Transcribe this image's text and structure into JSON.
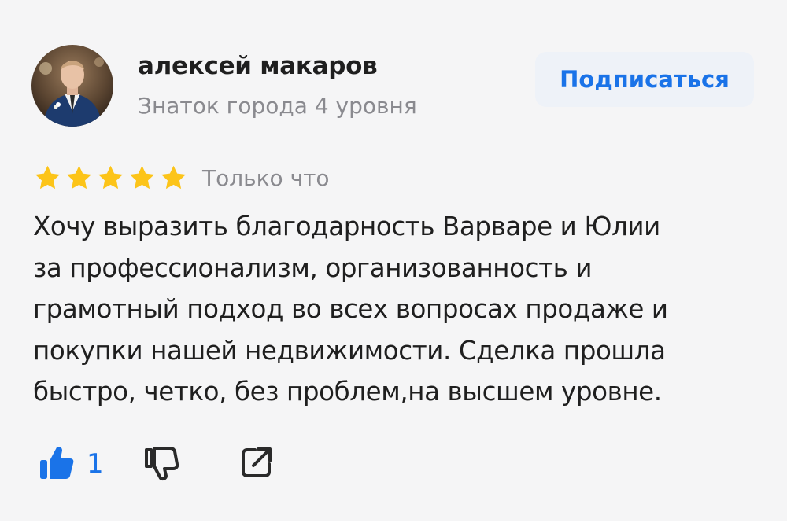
{
  "author": {
    "name": "алексей макаров",
    "level": "Знаток города 4 уровня"
  },
  "subscribe": {
    "label": "Подписаться"
  },
  "review": {
    "rating": 5,
    "max_rating": 5,
    "date": "Только что",
    "lines": [
      "Хочу выразить благодарность Варваре и Юлии",
      "за профессионализм, организованность и",
      "грамотный подход во всех вопросах продаже и",
      "покупки нашей недвижимости. Сделка прошла",
      "быстро, четко, без проблем,на высшем уровне."
    ]
  },
  "actions": {
    "like_count": "1",
    "like_icon": "thumbs-up-icon",
    "dislike_icon": "thumbs-down-icon",
    "share_icon": "share-icon"
  },
  "colors": {
    "accent": "#1a73e8",
    "star": "#fcc419",
    "background": "#f5f5f6",
    "text": "#1f1f1f",
    "muted": "#8a8a8f",
    "button_bg": "#eef2f8"
  }
}
